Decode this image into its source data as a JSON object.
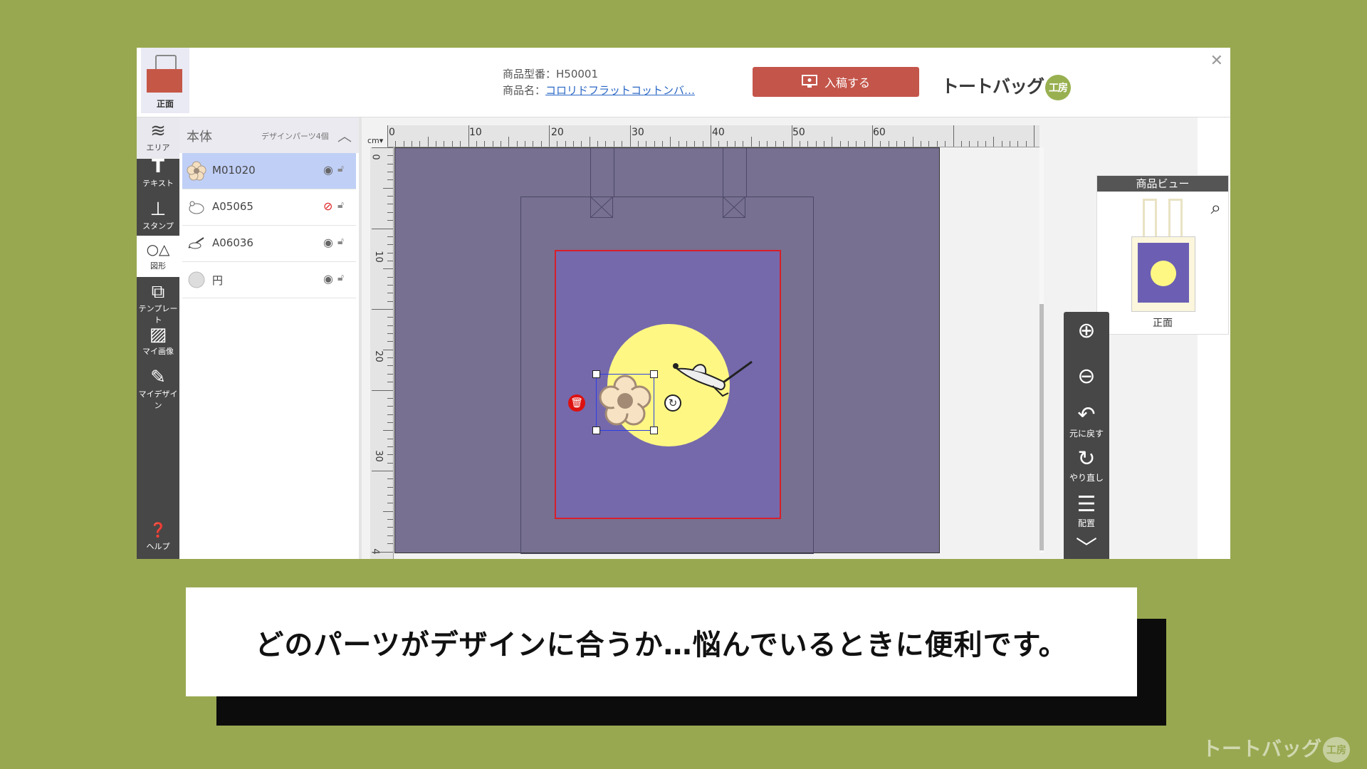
{
  "header": {
    "face_label": "正面",
    "product_code_label": "商品型番：",
    "product_code": "H50001",
    "product_name_label": "商品名：",
    "product_name": "コロリドフラットコットンバ…",
    "submit_label": "入稿する",
    "brand_name": "トートバッグ",
    "brand_badge": "工房",
    "close": "✕"
  },
  "toolbar": [
    {
      "label": "エリア",
      "icon": "layers-icon"
    },
    {
      "label": "テキスト",
      "icon": "text-icon"
    },
    {
      "label": "スタンプ",
      "icon": "stamp-icon"
    },
    {
      "label": "図形",
      "icon": "shapes-icon"
    },
    {
      "label": "テンプレート",
      "icon": "template-icon"
    },
    {
      "label": "マイ画像",
      "icon": "image-icon"
    },
    {
      "label": "マイデザイン",
      "icon": "my-design-icon"
    },
    {
      "label": "ヘルプ",
      "icon": "help-icon"
    }
  ],
  "layers": {
    "title": "本体",
    "count": "デザインパーツ4個",
    "items": [
      {
        "name": "M01020",
        "selected": true,
        "visible": true
      },
      {
        "name": "A05065",
        "selected": false,
        "visible": false
      },
      {
        "name": "A06036",
        "selected": false,
        "visible": true
      },
      {
        "name": "円",
        "selected": false,
        "visible": true
      }
    ]
  },
  "canvas": {
    "unit": "cm▾",
    "ruler_top": [
      "0",
      "10",
      "20",
      "30",
      "40",
      "50",
      "60"
    ],
    "ruler_left": [
      "0",
      "10",
      "20",
      "30",
      "4"
    ],
    "bag_color": "#777090",
    "print_area_color": "#7569ac",
    "moon_color": "#fff783"
  },
  "product_view": {
    "title": "商品ビュー",
    "face_label": "正面"
  },
  "zoombar": {
    "zoom_in": "",
    "zoom_out": "",
    "undo": "元に戻す",
    "redo": "やり直し",
    "align": "配置"
  },
  "caption": "どのパーツがデザインに合うか…悩んでいるときに便利です。",
  "watermark": {
    "text": "トートバッグ",
    "badge": "工房"
  }
}
